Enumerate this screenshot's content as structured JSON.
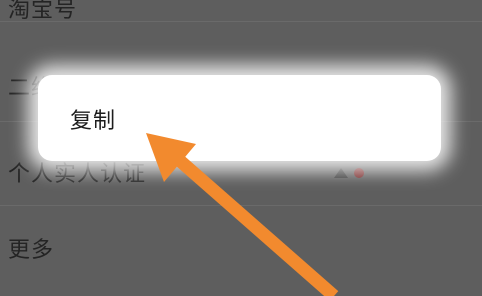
{
  "settings_list": {
    "items": [
      {
        "label": "淘宝号"
      },
      {
        "label": "二维码名片"
      },
      {
        "label": "个人实人认证"
      },
      {
        "label": "更多"
      }
    ]
  },
  "context_menu": {
    "copy_label": "复制"
  },
  "colors": {
    "dim_background": "#5e5e5e",
    "menu_background": "#ffffff",
    "arrow": "#f28a2e"
  }
}
